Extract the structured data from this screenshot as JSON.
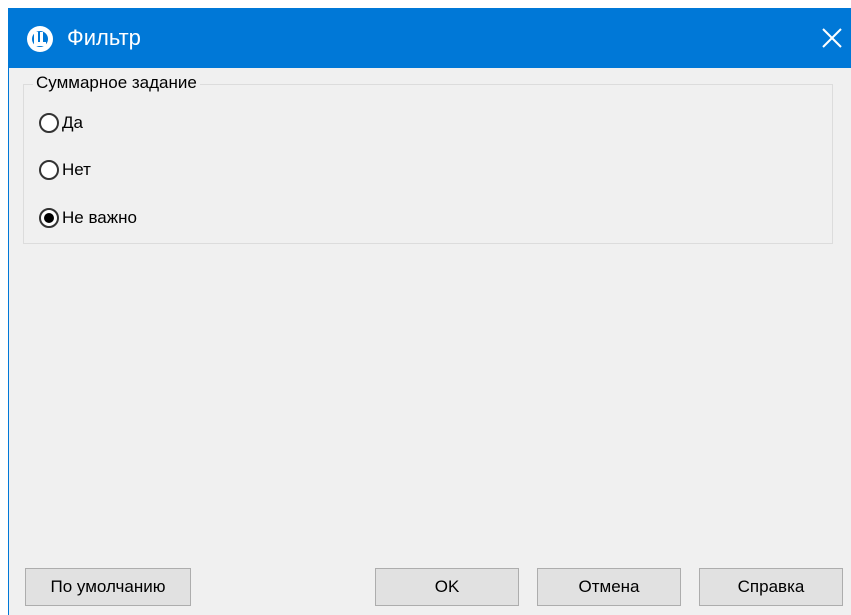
{
  "window": {
    "title": "Фильтр",
    "app_icon": "program-logo-icon",
    "close_icon": "close-icon",
    "accent_color": "#0078d7"
  },
  "filter": {
    "group_label": "Суммарное задание",
    "options": [
      {
        "label": "Да",
        "selected": false
      },
      {
        "label": "Нет",
        "selected": false
      },
      {
        "label": "Не важно",
        "selected": true
      }
    ]
  },
  "buttons": {
    "default_label": "По умолчанию",
    "ok_label": "OK",
    "cancel_label": "Отмена",
    "help_label": "Справка"
  }
}
